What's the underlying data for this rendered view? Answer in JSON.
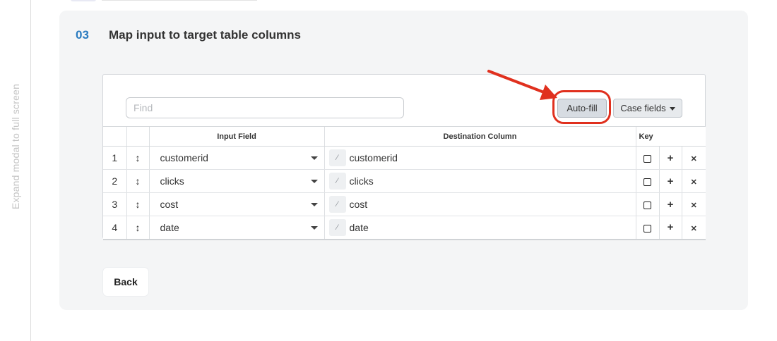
{
  "rail": {
    "label": "Expand modal to full screen"
  },
  "step": {
    "number": "03",
    "title": "Map input to target table columns"
  },
  "toolbar": {
    "find_placeholder": "Find",
    "autofill_label": "Auto-fill",
    "case_fields_label": "Case fields"
  },
  "table": {
    "headers": {
      "input": "Input Field",
      "destination": "Destination Column",
      "key": "Key"
    },
    "rows": [
      {
        "num": "1",
        "input": "customerid",
        "destination": "customerid"
      },
      {
        "num": "2",
        "input": "clicks",
        "destination": "clicks"
      },
      {
        "num": "3",
        "input": "cost",
        "destination": "cost"
      },
      {
        "num": "4",
        "input": "date",
        "destination": "date"
      }
    ]
  },
  "actions": {
    "back_label": "Back"
  },
  "icons": {
    "drag": "drag-handle-icon",
    "wand": "magic-wand-icon",
    "dropdown": "chevron-down-icon",
    "add": "plus-icon",
    "remove": "close-icon"
  },
  "colors": {
    "accent": "#2a7bc0",
    "annotation": "#e0301e",
    "card_bg": "#f4f5f6"
  }
}
